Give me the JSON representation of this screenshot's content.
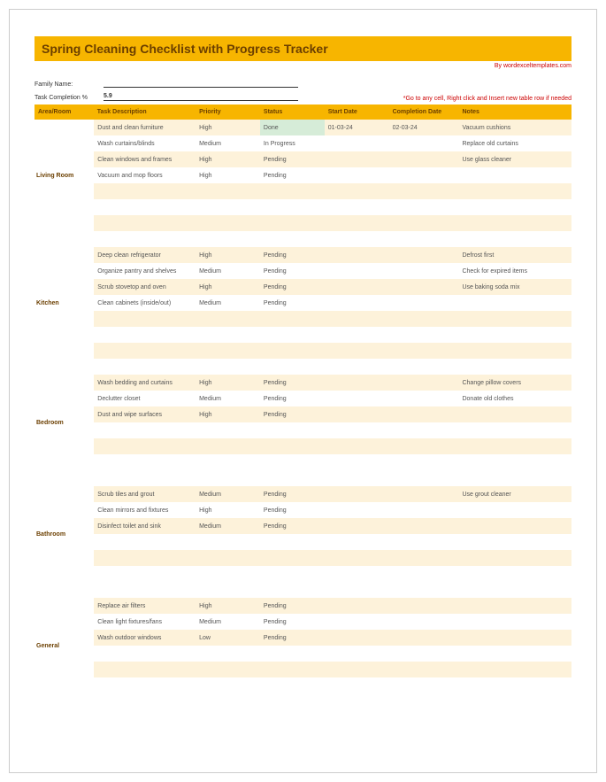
{
  "title": "Spring Cleaning Checklist with Progress Tracker",
  "credit": "By wordexceltemplates.com",
  "meta": {
    "family_label": "Family Name:",
    "family_value": "",
    "completion_label": "Task Completion %",
    "completion_value": "5.9"
  },
  "instruction": "*Go to any cell, Right click and Insert new table row if needed",
  "columns": [
    "Area/Room",
    "Task Description",
    "Priority",
    "Status",
    "Start Date",
    "Completion Date",
    "Notes"
  ],
  "rooms": [
    {
      "name": "Living Room",
      "rows": [
        {
          "desc": "Dust and clean furniture",
          "prio": "High",
          "status": "Done",
          "done": true,
          "start": "01-03-24",
          "comp": "02-03-24",
          "notes": "Vacuum cushions"
        },
        {
          "desc": "Wash curtains/blinds",
          "prio": "Medium",
          "status": "In Progress",
          "start": "",
          "comp": "",
          "notes": "Replace old curtains"
        },
        {
          "desc": "Clean windows and frames",
          "prio": "High",
          "status": "Pending",
          "start": "",
          "comp": "",
          "notes": "Use glass cleaner"
        },
        {
          "desc": "Vacuum and mop floors",
          "prio": "High",
          "status": "Pending",
          "start": "",
          "comp": "",
          "notes": ""
        },
        {
          "desc": "",
          "prio": "",
          "status": "",
          "start": "",
          "comp": "",
          "notes": ""
        },
        {
          "desc": "",
          "prio": "",
          "status": "",
          "start": "",
          "comp": "",
          "notes": ""
        },
        {
          "desc": "",
          "prio": "",
          "status": "",
          "start": "",
          "comp": "",
          "notes": ""
        }
      ]
    },
    {
      "name": "Kitchen",
      "rows": [
        {
          "desc": "Deep clean refrigerator",
          "prio": "High",
          "status": "Pending",
          "start": "",
          "comp": "",
          "notes": "Defrost first"
        },
        {
          "desc": "Organize pantry and shelves",
          "prio": "Medium",
          "status": "Pending",
          "start": "",
          "comp": "",
          "notes": "Check for expired items"
        },
        {
          "desc": "Scrub stovetop and oven",
          "prio": "High",
          "status": "Pending",
          "start": "",
          "comp": "",
          "notes": "Use baking soda mix"
        },
        {
          "desc": "Clean cabinets (inside/out)",
          "prio": "Medium",
          "status": "Pending",
          "start": "",
          "comp": "",
          "notes": ""
        },
        {
          "desc": "",
          "prio": "",
          "status": "",
          "start": "",
          "comp": "",
          "notes": ""
        },
        {
          "desc": "",
          "prio": "",
          "status": "",
          "start": "",
          "comp": "",
          "notes": ""
        },
        {
          "desc": "",
          "prio": "",
          "status": "",
          "start": "",
          "comp": "",
          "notes": ""
        }
      ]
    },
    {
      "name": "Bedroom",
      "rows": [
        {
          "desc": "Wash bedding and curtains",
          "prio": "High",
          "status": "Pending",
          "start": "",
          "comp": "",
          "notes": "Change pillow covers"
        },
        {
          "desc": "Declutter closet",
          "prio": "Medium",
          "status": "Pending",
          "start": "",
          "comp": "",
          "notes": "Donate old clothes"
        },
        {
          "desc": "Dust and wipe surfaces",
          "prio": "High",
          "status": "Pending",
          "start": "",
          "comp": "",
          "notes": ""
        },
        {
          "desc": "",
          "prio": "",
          "status": "",
          "start": "",
          "comp": "",
          "notes": ""
        },
        {
          "desc": "",
          "prio": "",
          "status": "",
          "start": "",
          "comp": "",
          "notes": ""
        },
        {
          "desc": "",
          "prio": "",
          "status": "",
          "start": "",
          "comp": "",
          "notes": ""
        }
      ]
    },
    {
      "name": "Bathroom",
      "rows": [
        {
          "desc": "Scrub tiles and grout",
          "prio": "Medium",
          "status": "Pending",
          "start": "",
          "comp": "",
          "notes": "Use grout cleaner"
        },
        {
          "desc": "Clean mirrors and fixtures",
          "prio": "High",
          "status": "Pending",
          "start": "",
          "comp": "",
          "notes": ""
        },
        {
          "desc": "Disinfect toilet and sink",
          "prio": "Medium",
          "status": "Pending",
          "start": "",
          "comp": "",
          "notes": ""
        },
        {
          "desc": "",
          "prio": "",
          "status": "",
          "start": "",
          "comp": "",
          "notes": ""
        },
        {
          "desc": "",
          "prio": "",
          "status": "",
          "start": "",
          "comp": "",
          "notes": ""
        },
        {
          "desc": "",
          "prio": "",
          "status": "",
          "start": "",
          "comp": "",
          "notes": ""
        }
      ]
    },
    {
      "name": "General",
      "rows": [
        {
          "desc": "Replace air filters",
          "prio": "High",
          "status": "Pending",
          "start": "",
          "comp": "",
          "notes": ""
        },
        {
          "desc": "Clean light fixtures/fans",
          "prio": "Medium",
          "status": "Pending",
          "start": "",
          "comp": "",
          "notes": ""
        },
        {
          "desc": "Wash outdoor windows",
          "prio": "Low",
          "status": "Pending",
          "start": "",
          "comp": "",
          "notes": ""
        },
        {
          "desc": "",
          "prio": "",
          "status": "",
          "start": "",
          "comp": "",
          "notes": ""
        },
        {
          "desc": "",
          "prio": "",
          "status": "",
          "start": "",
          "comp": "",
          "notes": ""
        },
        {
          "desc": "",
          "prio": "",
          "status": "",
          "start": "",
          "comp": "",
          "notes": ""
        }
      ]
    }
  ]
}
